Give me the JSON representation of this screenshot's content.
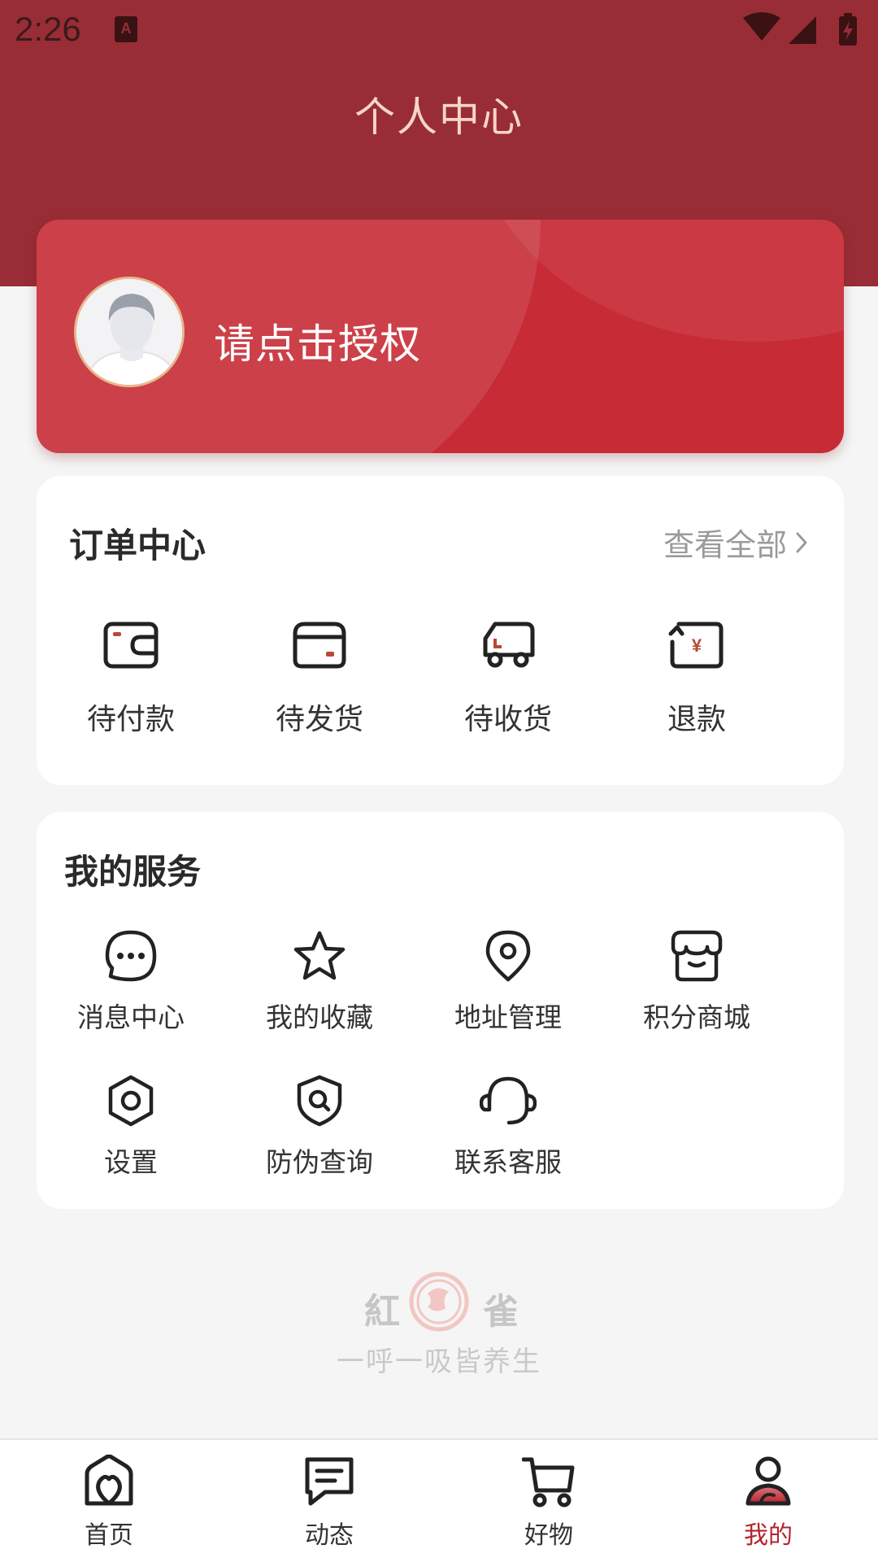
{
  "status_bar": {
    "time": "2:26",
    "app_icon_letter": "A"
  },
  "header": {
    "title": "个人中心"
  },
  "profile": {
    "name": "请点击授权"
  },
  "orders": {
    "title": "订单中心",
    "see_all": "查看全部",
    "items": [
      {
        "label": "待付款",
        "icon": "wallet-icon"
      },
      {
        "label": "待发货",
        "icon": "package-icon"
      },
      {
        "label": "待收货",
        "icon": "truck-icon"
      },
      {
        "label": "退款",
        "icon": "refund-icon"
      }
    ]
  },
  "services": {
    "title": "我的服务",
    "items": [
      {
        "label": "消息中心",
        "icon": "chat-bubble-icon"
      },
      {
        "label": "我的收藏",
        "icon": "star-icon"
      },
      {
        "label": "地址管理",
        "icon": "location-pin-icon"
      },
      {
        "label": "积分商城",
        "icon": "store-icon"
      },
      {
        "label": "设置",
        "icon": "settings-hexagon-icon"
      },
      {
        "label": "防伪查询",
        "icon": "shield-search-icon"
      },
      {
        "label": "联系客服",
        "icon": "headset-icon"
      }
    ]
  },
  "brand": {
    "name_left": "紅",
    "name_right": "雀",
    "slogan": "一呼一吸皆养生"
  },
  "bottom_nav": {
    "items": [
      {
        "label": "首页",
        "icon": "home-icon",
        "active": false
      },
      {
        "label": "动态",
        "icon": "news-icon",
        "active": false
      },
      {
        "label": "好物",
        "icon": "cart-icon",
        "active": false
      },
      {
        "label": "我的",
        "icon": "profile-icon",
        "active": true
      }
    ]
  },
  "colors": {
    "header_bg": "#992d35",
    "profile_card": "#c72b35",
    "accent": "#b4242e",
    "page_bg": "#f5f5f5"
  }
}
